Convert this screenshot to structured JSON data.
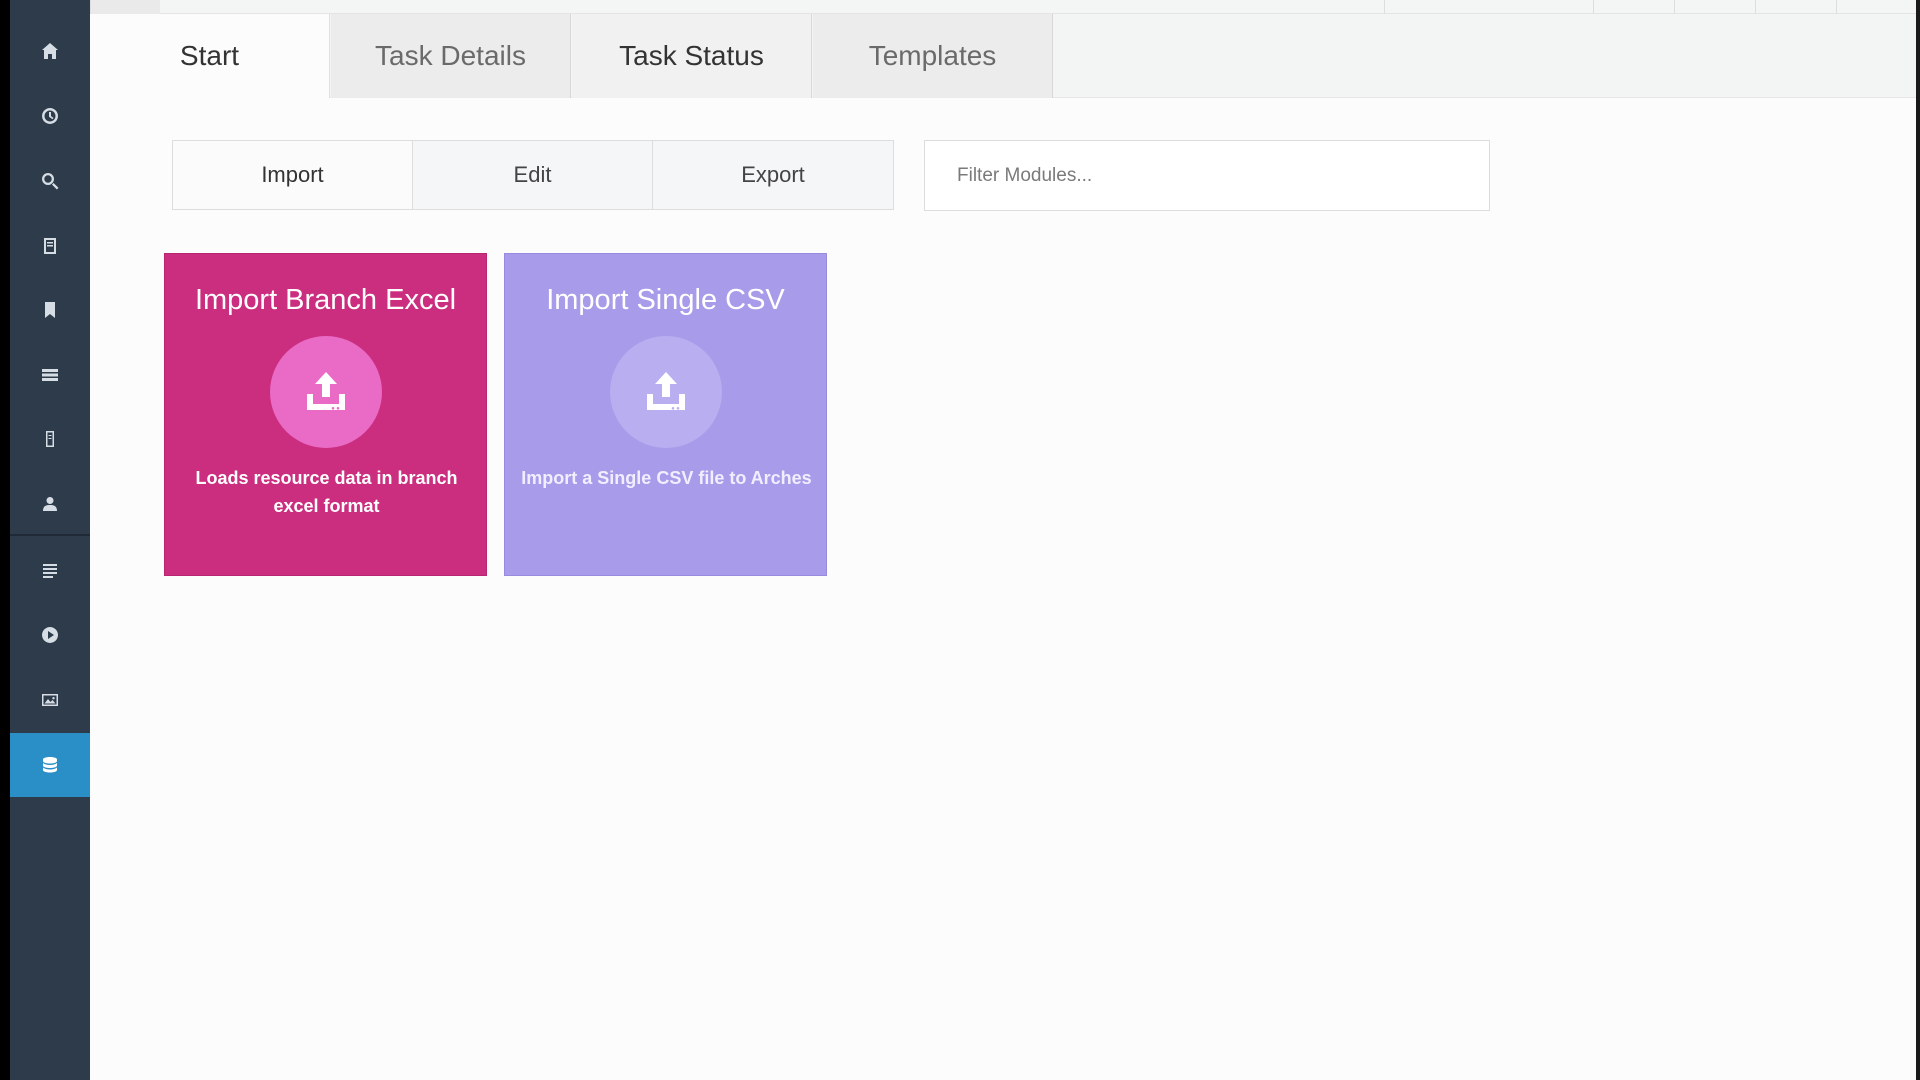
{
  "sidebar": {
    "items": [
      {
        "icon": "home-icon"
      },
      {
        "icon": "clock-icon"
      },
      {
        "icon": "search-icon"
      },
      {
        "icon": "document-icon"
      },
      {
        "icon": "bookmark-icon"
      },
      {
        "icon": "list-icon"
      },
      {
        "icon": "file-icon"
      },
      {
        "icon": "user-icon"
      },
      {
        "icon": "lines-icon"
      },
      {
        "icon": "play-icon"
      },
      {
        "icon": "image-icon"
      },
      {
        "icon": "database-icon",
        "active": true
      }
    ],
    "active_color": "#2a8fc7",
    "background": "#2d3b4b"
  },
  "tabs": [
    {
      "label": "Start",
      "active": true
    },
    {
      "label": "Task Details"
    },
    {
      "label": "Task Status"
    },
    {
      "label": "Templates"
    }
  ],
  "toolbar": {
    "import_label": "Import",
    "edit_label": "Edit",
    "export_label": "Export",
    "active": "Import"
  },
  "filter": {
    "placeholder": "Filter Modules..."
  },
  "modules": [
    {
      "title": "Import Branch Excel",
      "icon": "upload-icon",
      "description": "Loads resource data in branch excel format",
      "color": "#cb2d7f"
    },
    {
      "title": "Import Single CSV",
      "icon": "upload-icon",
      "description": "Import a Single CSV file to Arches",
      "color": "#a89bea"
    }
  ]
}
